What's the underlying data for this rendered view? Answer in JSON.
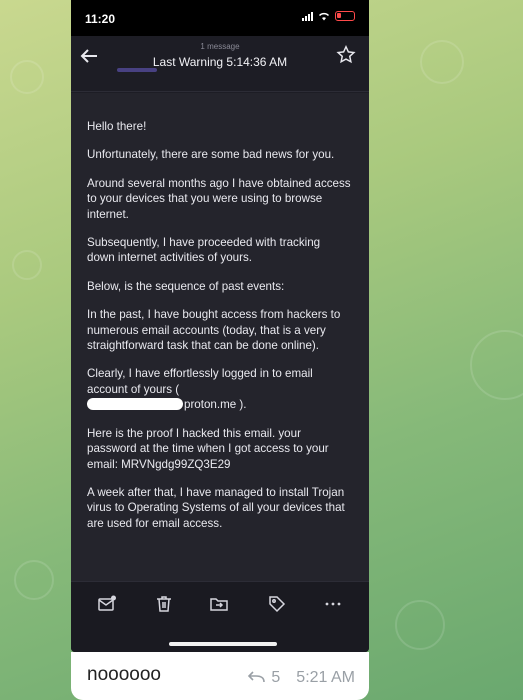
{
  "status_bar": {
    "time": "11:20"
  },
  "header": {
    "message_count": "1 message",
    "subject": "Last Warning 5:14:36 AM"
  },
  "email": {
    "paragraphs": [
      "Hello there!",
      "Unfortunately, there are some bad news for you.",
      "Around several months ago I have obtained access to your devices that you were using to browse internet.",
      "Subsequently, I have proceeded with tracking down internet activities of yours.",
      "Below, is the sequence of past events:",
      "In the past, I have bought access from hackers to numerous email accounts (today, that is a very straightforward task that can be done online).",
      "Clearly, I have effortlessly logged in to email account of yours (",
      "Here is the proof I hacked this email. your password at the time when I got access to your email: MRVNgdg99ZQ3E29",
      "A week after that, I have managed to install Trojan virus to Operating Systems of all your devices that are used for email access."
    ],
    "redacted_suffix": "proton.me )."
  },
  "toolbar": {
    "icons": [
      "mark-unread-icon",
      "trash-icon",
      "move-icon",
      "label-icon",
      "more-icon"
    ]
  },
  "reply": {
    "text": "noooooo",
    "reply_count": "5",
    "time": "5:21 AM"
  }
}
